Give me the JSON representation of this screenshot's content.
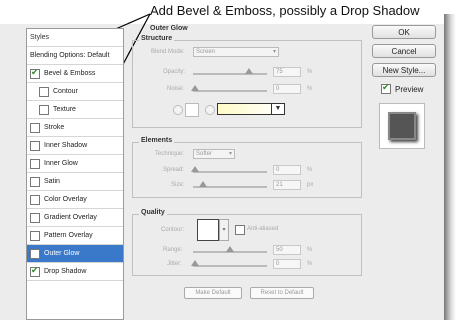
{
  "annotation": "Add Bevel & Emboss, possibly a Drop Shadow",
  "styles_list": {
    "header": "Styles",
    "blending": "Blending Options: Default",
    "items": [
      {
        "label": "Bevel & Emboss",
        "checked": true,
        "indent": false,
        "selected": false
      },
      {
        "label": "Contour",
        "checked": false,
        "indent": true,
        "selected": false
      },
      {
        "label": "Texture",
        "checked": false,
        "indent": true,
        "selected": false
      },
      {
        "label": "Stroke",
        "checked": false,
        "indent": false,
        "selected": false
      },
      {
        "label": "Inner Shadow",
        "checked": false,
        "indent": false,
        "selected": false
      },
      {
        "label": "Inner Glow",
        "checked": false,
        "indent": false,
        "selected": false
      },
      {
        "label": "Satin",
        "checked": false,
        "indent": false,
        "selected": false
      },
      {
        "label": "Color Overlay",
        "checked": false,
        "indent": false,
        "selected": false
      },
      {
        "label": "Gradient Overlay",
        "checked": false,
        "indent": false,
        "selected": false
      },
      {
        "label": "Pattern Overlay",
        "checked": false,
        "indent": false,
        "selected": false
      },
      {
        "label": "Outer Glow",
        "checked": false,
        "indent": false,
        "selected": true
      },
      {
        "label": "Drop Shadow",
        "checked": true,
        "indent": false,
        "selected": false
      }
    ]
  },
  "panel": {
    "title": "Outer Glow",
    "structure": {
      "title": "Structure",
      "blend_mode_label": "Blend Mode:",
      "blend_mode_value": "Screen",
      "opacity_label": "Opacity:",
      "opacity_value": "75",
      "noise_label": "Noise:",
      "noise_value": "0",
      "percent": "%"
    },
    "elements": {
      "title": "Elements",
      "technique_label": "Technique:",
      "technique_value": "Softer",
      "spread_label": "Spread:",
      "spread_value": "0",
      "size_label": "Size:",
      "size_value": "21",
      "percent": "%",
      "px": "px"
    },
    "quality": {
      "title": "Quality",
      "contour_label": "Contour:",
      "anti_aliased_label": "Anti-aliased",
      "range_label": "Range:",
      "range_value": "50",
      "jitter_label": "Jitter:",
      "jitter_value": "0",
      "percent": "%"
    },
    "make_default": "Make Default",
    "reset_default": "Reset to Default"
  },
  "buttons": {
    "ok": "OK",
    "cancel": "Cancel",
    "new_style": "New Style...",
    "preview_label": "Preview",
    "preview_checked": true
  }
}
